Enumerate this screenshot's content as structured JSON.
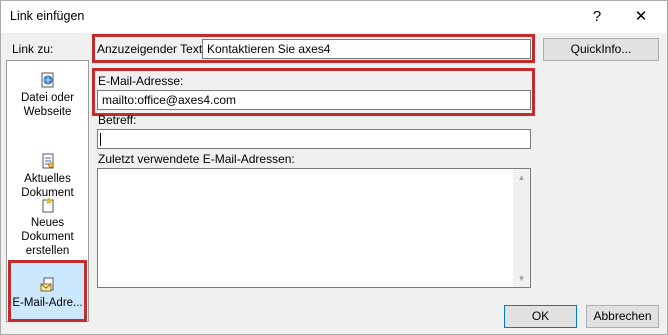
{
  "window": {
    "title": "Link einfügen",
    "help": "?",
    "close": "✕"
  },
  "link_to": {
    "label": "Link zu:",
    "items": [
      {
        "label_line1": "Datei oder",
        "label_line2": "Webseite",
        "icon": "globe-page-icon"
      },
      {
        "label_line1": "Aktuelles",
        "label_line2": "Dokument",
        "icon": "document-icon"
      },
      {
        "label_line1": "Neues",
        "label_line2": "Dokument",
        "label_line3": "erstellen",
        "icon": "new-document-icon"
      },
      {
        "label_line1": "E-Mail-Adre...",
        "icon": "email-icon",
        "selected": true
      }
    ]
  },
  "display_text": {
    "label": "Anzuzeigender Text:",
    "value": "Kontaktieren Sie axes4"
  },
  "email": {
    "label": "E-Mail-Adresse:",
    "value": "mailto:office@axes4.com"
  },
  "subject": {
    "label": "Betreff:",
    "value": ""
  },
  "recent": {
    "label": "Zuletzt verwendete E-Mail-Adressen:"
  },
  "buttons": {
    "quickinfo": "QuickInfo...",
    "ok": "OK",
    "cancel": "Abbrechen"
  },
  "colors": {
    "highlight": "#c42b2b",
    "selection": "#cce8ff",
    "accent": "#0078d7"
  }
}
